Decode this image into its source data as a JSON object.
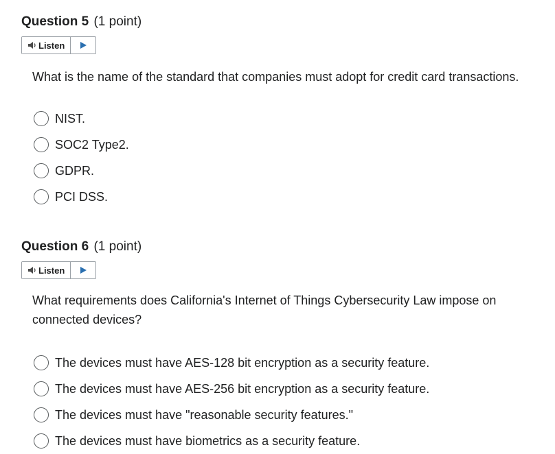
{
  "questions": [
    {
      "title": "Question 5",
      "points": "(1 point)",
      "listen_label": "Listen",
      "text": "What is the name of the standard that companies must adopt for credit card transactions.",
      "options": [
        "NIST.",
        "SOC2 Type2.",
        "GDPR.",
        "PCI DSS."
      ]
    },
    {
      "title": "Question 6",
      "points": "(1 point)",
      "listen_label": "Listen",
      "text": "What requirements does California's Internet of Things Cybersecurity Law impose on connected devices?",
      "options": [
        "The devices must have AES-128 bit encryption as a security feature.",
        "The devices must have AES-256 bit encryption as a security feature.",
        "The devices must have \"reasonable security features.\"",
        "The devices must have biometrics as a security feature."
      ]
    }
  ],
  "icons": {
    "speaker": "speaker-icon",
    "play": "play-icon"
  },
  "colors": {
    "play_arrow": "#2a6fb0",
    "speaker": "#4a4a4a",
    "text": "#202122",
    "radio_border": "#565a5c"
  }
}
